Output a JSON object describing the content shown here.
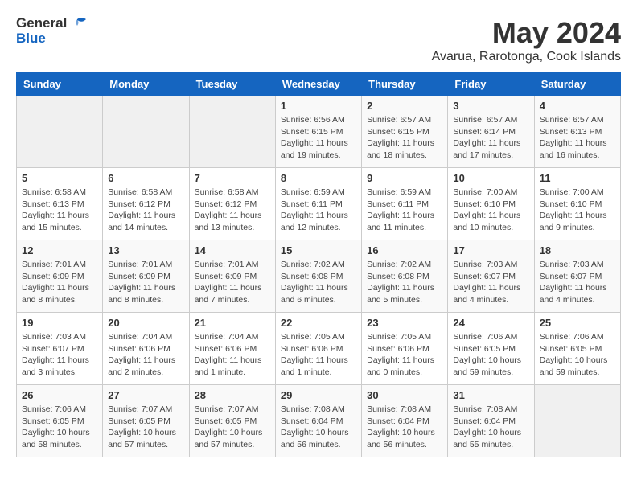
{
  "header": {
    "logo_general": "General",
    "logo_blue": "Blue",
    "month_year": "May 2024",
    "location": "Avarua, Rarotonga, Cook Islands"
  },
  "days_of_week": [
    "Sunday",
    "Monday",
    "Tuesday",
    "Wednesday",
    "Thursday",
    "Friday",
    "Saturday"
  ],
  "weeks": [
    [
      {
        "day": "",
        "info": ""
      },
      {
        "day": "",
        "info": ""
      },
      {
        "day": "",
        "info": ""
      },
      {
        "day": "1",
        "info": "Sunrise: 6:56 AM\nSunset: 6:15 PM\nDaylight: 11 hours and 19 minutes."
      },
      {
        "day": "2",
        "info": "Sunrise: 6:57 AM\nSunset: 6:15 PM\nDaylight: 11 hours and 18 minutes."
      },
      {
        "day": "3",
        "info": "Sunrise: 6:57 AM\nSunset: 6:14 PM\nDaylight: 11 hours and 17 minutes."
      },
      {
        "day": "4",
        "info": "Sunrise: 6:57 AM\nSunset: 6:13 PM\nDaylight: 11 hours and 16 minutes."
      }
    ],
    [
      {
        "day": "5",
        "info": "Sunrise: 6:58 AM\nSunset: 6:13 PM\nDaylight: 11 hours and 15 minutes."
      },
      {
        "day": "6",
        "info": "Sunrise: 6:58 AM\nSunset: 6:12 PM\nDaylight: 11 hours and 14 minutes."
      },
      {
        "day": "7",
        "info": "Sunrise: 6:58 AM\nSunset: 6:12 PM\nDaylight: 11 hours and 13 minutes."
      },
      {
        "day": "8",
        "info": "Sunrise: 6:59 AM\nSunset: 6:11 PM\nDaylight: 11 hours and 12 minutes."
      },
      {
        "day": "9",
        "info": "Sunrise: 6:59 AM\nSunset: 6:11 PM\nDaylight: 11 hours and 11 minutes."
      },
      {
        "day": "10",
        "info": "Sunrise: 7:00 AM\nSunset: 6:10 PM\nDaylight: 11 hours and 10 minutes."
      },
      {
        "day": "11",
        "info": "Sunrise: 7:00 AM\nSunset: 6:10 PM\nDaylight: 11 hours and 9 minutes."
      }
    ],
    [
      {
        "day": "12",
        "info": "Sunrise: 7:01 AM\nSunset: 6:09 PM\nDaylight: 11 hours and 8 minutes."
      },
      {
        "day": "13",
        "info": "Sunrise: 7:01 AM\nSunset: 6:09 PM\nDaylight: 11 hours and 8 minutes."
      },
      {
        "day": "14",
        "info": "Sunrise: 7:01 AM\nSunset: 6:09 PM\nDaylight: 11 hours and 7 minutes."
      },
      {
        "day": "15",
        "info": "Sunrise: 7:02 AM\nSunset: 6:08 PM\nDaylight: 11 hours and 6 minutes."
      },
      {
        "day": "16",
        "info": "Sunrise: 7:02 AM\nSunset: 6:08 PM\nDaylight: 11 hours and 5 minutes."
      },
      {
        "day": "17",
        "info": "Sunrise: 7:03 AM\nSunset: 6:07 PM\nDaylight: 11 hours and 4 minutes."
      },
      {
        "day": "18",
        "info": "Sunrise: 7:03 AM\nSunset: 6:07 PM\nDaylight: 11 hours and 4 minutes."
      }
    ],
    [
      {
        "day": "19",
        "info": "Sunrise: 7:03 AM\nSunset: 6:07 PM\nDaylight: 11 hours and 3 minutes."
      },
      {
        "day": "20",
        "info": "Sunrise: 7:04 AM\nSunset: 6:06 PM\nDaylight: 11 hours and 2 minutes."
      },
      {
        "day": "21",
        "info": "Sunrise: 7:04 AM\nSunset: 6:06 PM\nDaylight: 11 hours and 1 minute."
      },
      {
        "day": "22",
        "info": "Sunrise: 7:05 AM\nSunset: 6:06 PM\nDaylight: 11 hours and 1 minute."
      },
      {
        "day": "23",
        "info": "Sunrise: 7:05 AM\nSunset: 6:06 PM\nDaylight: 11 hours and 0 minutes."
      },
      {
        "day": "24",
        "info": "Sunrise: 7:06 AM\nSunset: 6:05 PM\nDaylight: 10 hours and 59 minutes."
      },
      {
        "day": "25",
        "info": "Sunrise: 7:06 AM\nSunset: 6:05 PM\nDaylight: 10 hours and 59 minutes."
      }
    ],
    [
      {
        "day": "26",
        "info": "Sunrise: 7:06 AM\nSunset: 6:05 PM\nDaylight: 10 hours and 58 minutes."
      },
      {
        "day": "27",
        "info": "Sunrise: 7:07 AM\nSunset: 6:05 PM\nDaylight: 10 hours and 57 minutes."
      },
      {
        "day": "28",
        "info": "Sunrise: 7:07 AM\nSunset: 6:05 PM\nDaylight: 10 hours and 57 minutes."
      },
      {
        "day": "29",
        "info": "Sunrise: 7:08 AM\nSunset: 6:04 PM\nDaylight: 10 hours and 56 minutes."
      },
      {
        "day": "30",
        "info": "Sunrise: 7:08 AM\nSunset: 6:04 PM\nDaylight: 10 hours and 56 minutes."
      },
      {
        "day": "31",
        "info": "Sunrise: 7:08 AM\nSunset: 6:04 PM\nDaylight: 10 hours and 55 minutes."
      },
      {
        "day": "",
        "info": ""
      }
    ]
  ]
}
